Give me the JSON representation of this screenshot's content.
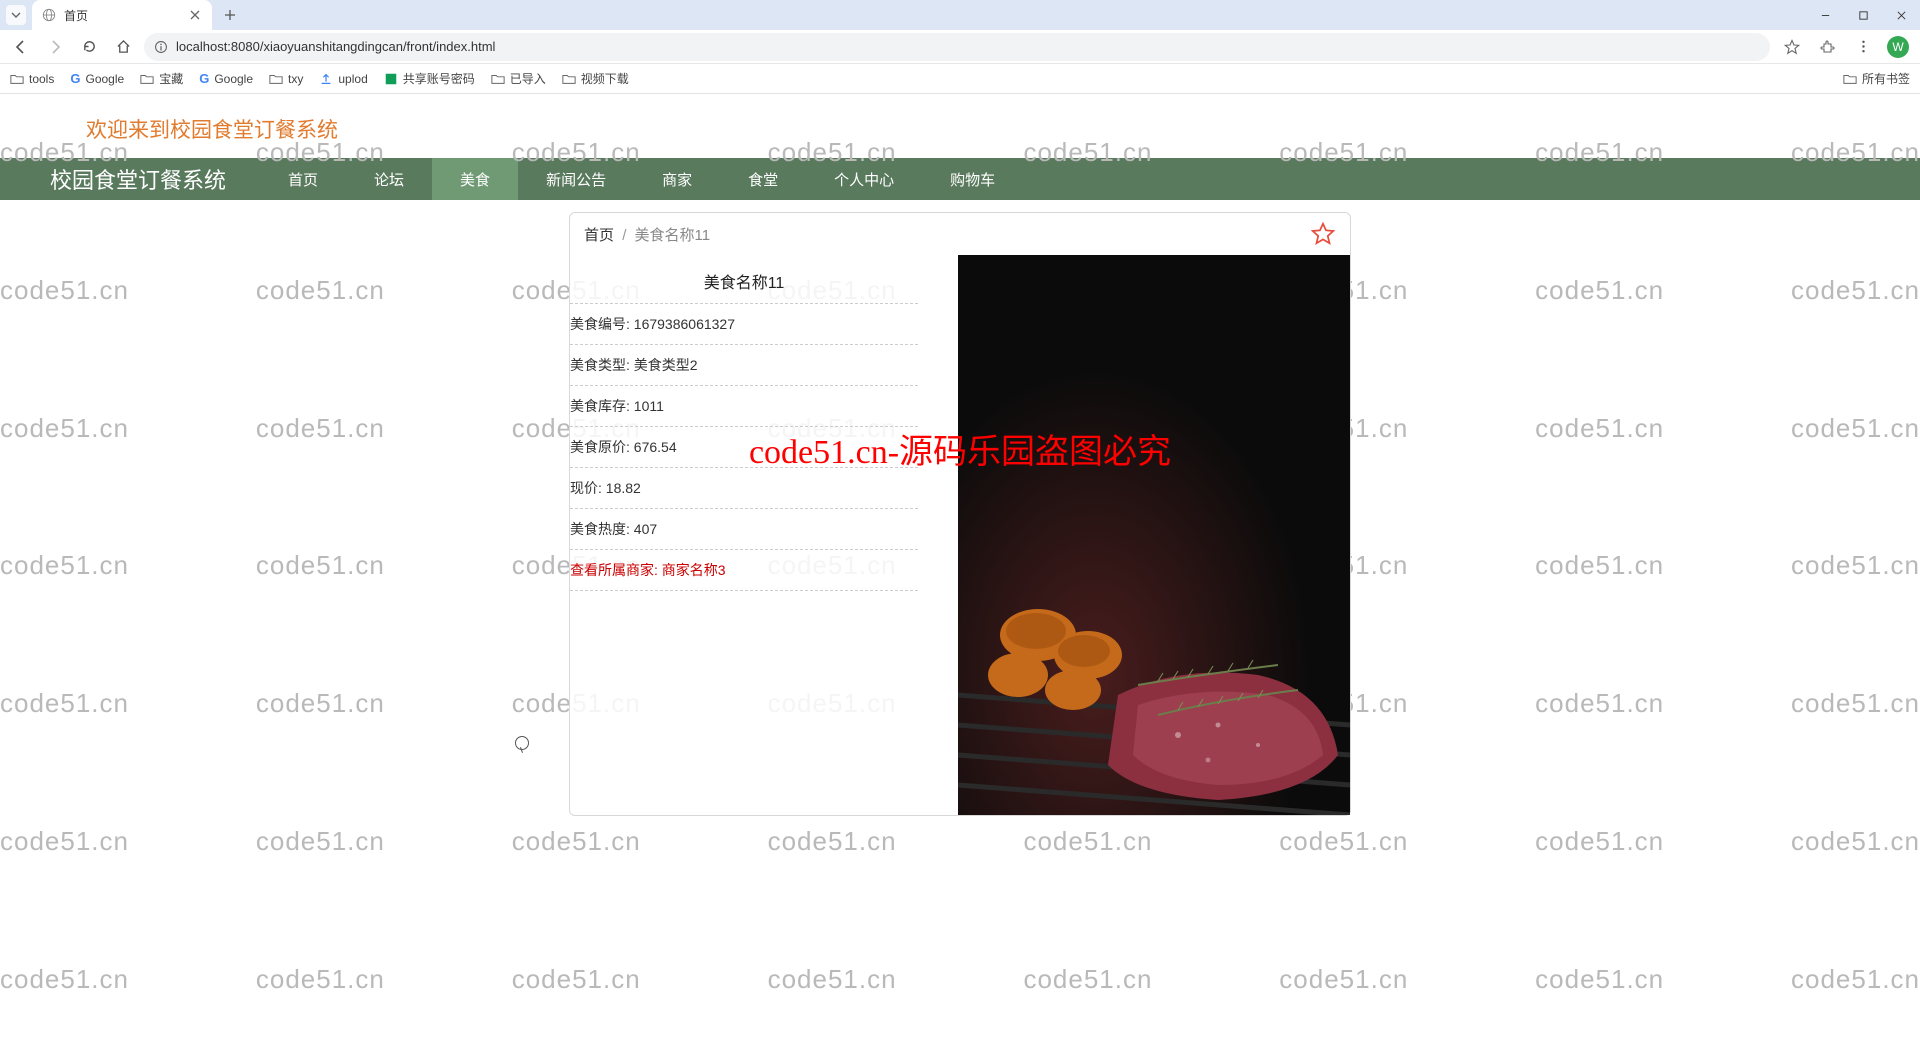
{
  "browser": {
    "tab_title": "首页",
    "url": "localhost:8080/xiaoyuanshitangdingcan/front/index.html",
    "avatar_letter": "W"
  },
  "bookmarks": [
    "tools",
    "Google",
    "宝藏",
    "Google",
    "txy",
    "uplod",
    "共享账号密码",
    "已导入",
    "视频下载"
  ],
  "bookmarks_right": "所有书签",
  "welcome_text": "欢迎来到校园食堂订餐系统",
  "brand": "校园食堂订餐系统",
  "menu": [
    "首页",
    "论坛",
    "美食",
    "新闻公告",
    "商家",
    "食堂",
    "个人中心",
    "购物车"
  ],
  "menu_active_index": 2,
  "breadcrumb": {
    "home": "首页",
    "current": "美食名称11"
  },
  "item": {
    "title": "美食名称11",
    "fields": [
      {
        "label": "美食编号:",
        "value": "1679386061327"
      },
      {
        "label": "美食类型:",
        "value": "美食类型2"
      },
      {
        "label": "美食库存:",
        "value": "1011"
      },
      {
        "label": "美食原价:",
        "value": "676.54"
      },
      {
        "label": "现价:",
        "value": "18.82"
      },
      {
        "label": "美食热度:",
        "value": "407"
      }
    ],
    "merchant": {
      "label": "查看所属商家:",
      "value": "商家名称3"
    }
  },
  "watermark": "code51.cn",
  "watermark_center": "code51.cn-源码乐园盗图必究"
}
